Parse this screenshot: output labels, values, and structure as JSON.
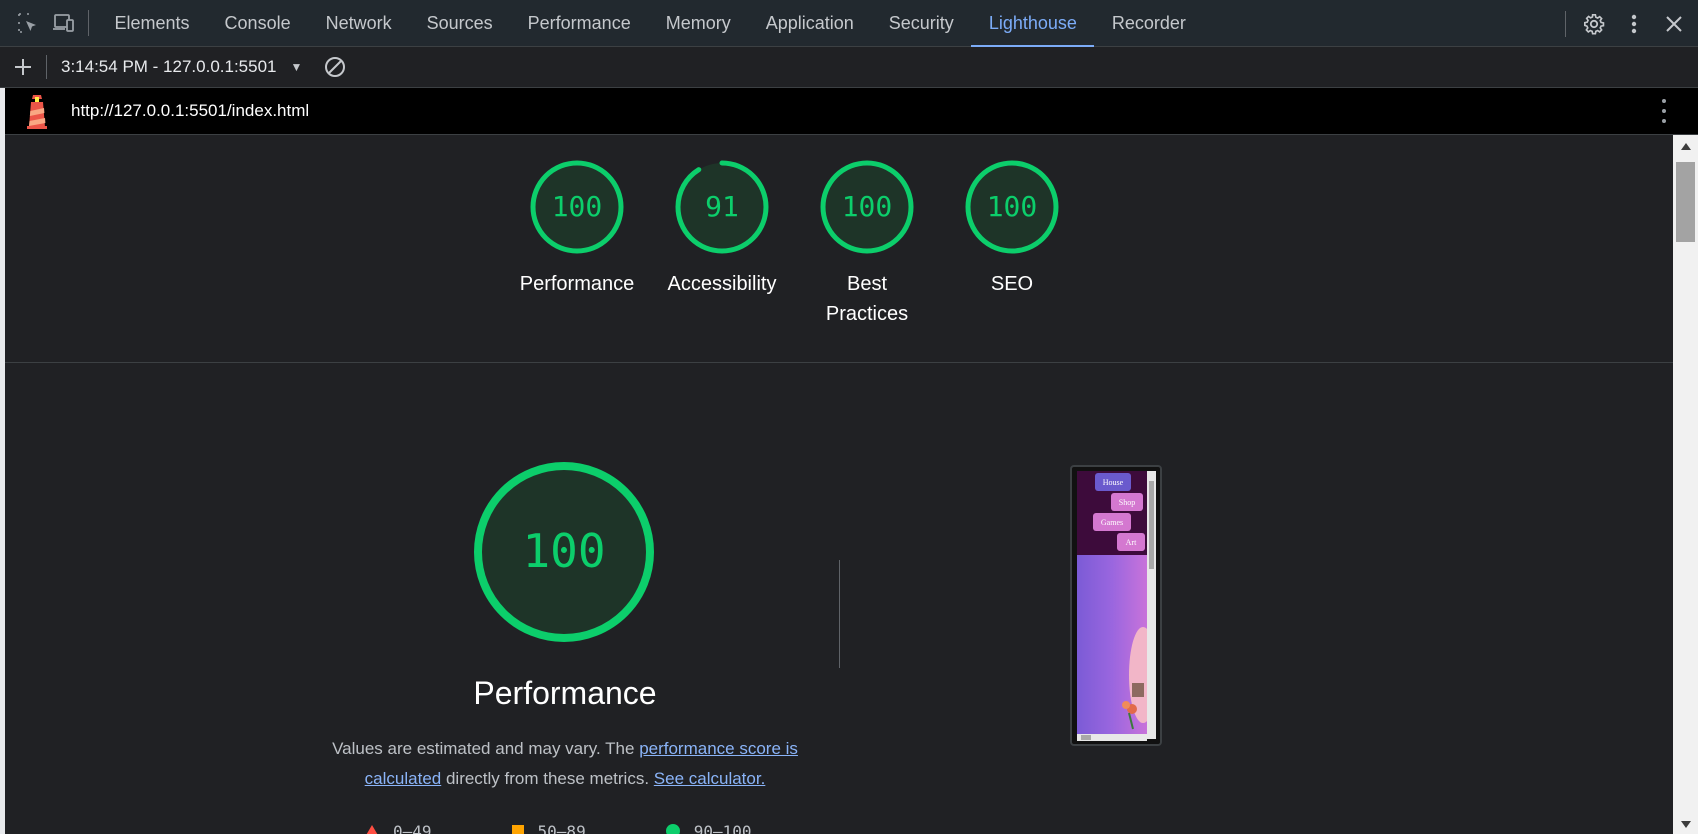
{
  "tabs": [
    "Elements",
    "Console",
    "Network",
    "Sources",
    "Performance",
    "Memory",
    "Application",
    "Security",
    "Lighthouse",
    "Recorder"
  ],
  "active_tab": "Lighthouse",
  "tab_icons": {
    "inspect": "inspect-element-icon",
    "device": "device-toolbar-icon",
    "settings": "gear-icon",
    "more": "kebab-menu-icon",
    "close": "close-icon"
  },
  "toolbar": {
    "new_report": "+",
    "report_label": "3:14:54 PM - 127.0.0.1:5501",
    "clear_icon": "block-icon"
  },
  "urlbar": {
    "url": "http://127.0.0.1:5501/index.html",
    "logo": "lighthouse-logo-icon"
  },
  "scores": [
    {
      "value": "100",
      "label": "Performance",
      "fraction": 1.0
    },
    {
      "value": "91",
      "label": "Accessibility",
      "fraction": 0.91
    },
    {
      "value": "100",
      "label": "Best Practices",
      "fraction": 1.0
    },
    {
      "value": "100",
      "label": "SEO",
      "fraction": 1.0
    }
  ],
  "performance": {
    "score": "100",
    "title": "Performance",
    "desc_prefix": "Values are estimated and may vary. The ",
    "desc_link1": "performance score is calculated",
    "desc_middle": " directly from these metrics. ",
    "desc_link2": "See calculator."
  },
  "legend": [
    {
      "range": "0–49",
      "shape": "triangle",
      "color": "#ff4e42"
    },
    {
      "range": "50–89",
      "shape": "square",
      "color": "#ffa400"
    },
    {
      "range": "90–100",
      "shape": "circle",
      "color": "#0cce6b"
    }
  ],
  "thumbnail": {
    "nav": [
      "House",
      "Shop",
      "Games",
      "Art"
    ]
  },
  "colors": {
    "pass": "#0cce6b",
    "gauge_bg": "#1e3428",
    "link": "#8ab4f8",
    "active_tab": "#7cacf8"
  }
}
